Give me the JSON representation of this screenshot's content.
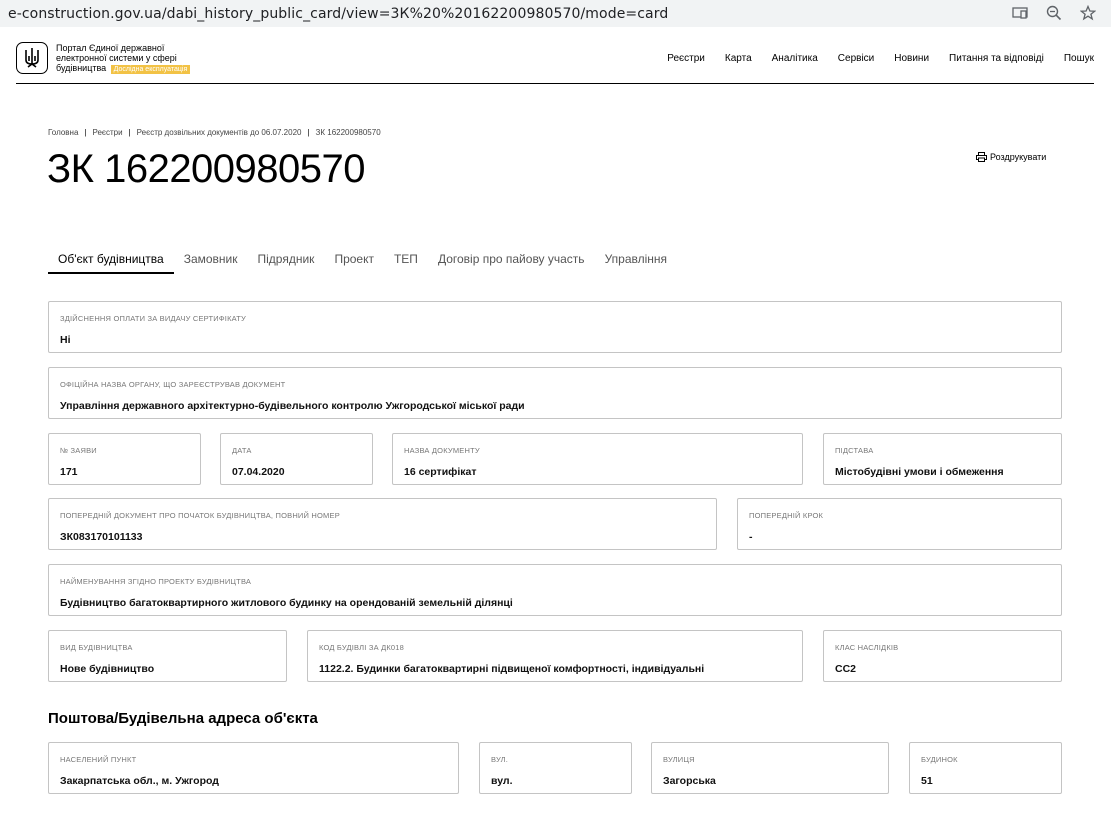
{
  "browser": {
    "url": "e-construction.gov.ua/dabi_history_public_card/view=3К%20%20162200980570/mode=card"
  },
  "header": {
    "logo_text": "Портал Єдиної державної електронної системи у сфері будівництва",
    "beta": "Дослідна експлуатація",
    "nav": [
      "Реєстри",
      "Карта",
      "Аналітика",
      "Сервіси",
      "Новини",
      "Питання та відповіді",
      "Пошук"
    ]
  },
  "breadcrumb": [
    "Головна",
    "Реєстри",
    "Реєстр дозвільних документів до 06.07.2020",
    "ЗК 162200980570"
  ],
  "title": "ЗК 162200980570",
  "print_label": "Роздрукувати",
  "tabs": [
    "Об'єкт будівництва",
    "Замовник",
    "Підрядник",
    "Проект",
    "ТЕП",
    "Договір про пайову участь",
    "Управління"
  ],
  "fields": {
    "payment": {
      "label": "Здійснення оплати за видачу сертифікату",
      "value": "Ні"
    },
    "authority": {
      "label": "Офіційна назва органу, що зареєстрував документ",
      "value": "Управління державного архітектурно-будівельного контролю Ужгородської міської ради"
    },
    "app_no": {
      "label": "№ заяви",
      "value": "171"
    },
    "date": {
      "label": "Дата",
      "value": "07.04.2020"
    },
    "doc_name": {
      "label": "Назва документу",
      "value": "16 сертифікат"
    },
    "basis": {
      "label": "Підстава",
      "value": "Містобудівні умови і обмеження"
    },
    "prev_doc": {
      "label": "Попередній документ про початок будівництва, повний номер",
      "value": "ЗК083170101133"
    },
    "prev_step": {
      "label": "Попередній крок",
      "value": "-"
    },
    "project_name": {
      "label": "Найменування згідно проекту будівництва",
      "value": "Будівництво багатоквартирного житлового будинку на орендованій земельній ділянці"
    },
    "constr_type": {
      "label": "Вид будівництва",
      "value": "Нове будівництво"
    },
    "building_code": {
      "label": "Код будівлі за ДК018",
      "value": "1122.2. Будинки багатоквартирні підвищеної комфортності, індивідуальні"
    },
    "consequence": {
      "label": "Клас наслідків",
      "value": "СС2"
    }
  },
  "address": {
    "title": "Поштова/Будівельна адреса об'єкта",
    "locality": {
      "label": "Населений пункт",
      "value": "Закарпатська обл., м. Ужгород"
    },
    "street_type": {
      "label": "Вул.",
      "value": "вул."
    },
    "street": {
      "label": "Вулиця",
      "value": "Загорська"
    },
    "building": {
      "label": "Будинок",
      "value": "51"
    }
  }
}
